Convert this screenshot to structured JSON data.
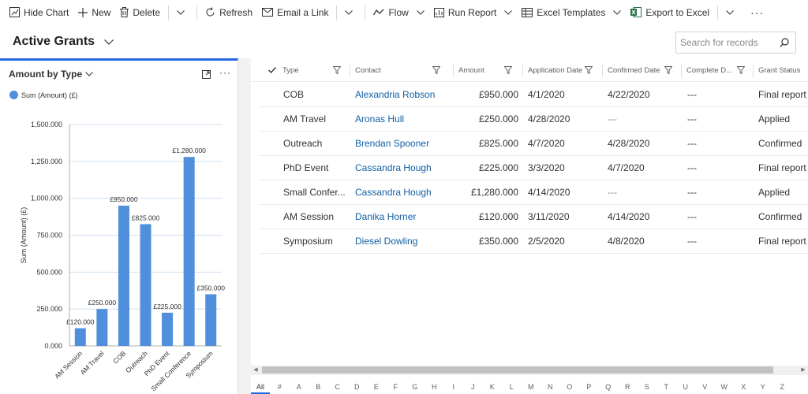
{
  "toolbar": {
    "hide_chart": "Hide Chart",
    "new": "New",
    "delete": "Delete",
    "refresh": "Refresh",
    "email_link": "Email a Link",
    "flow": "Flow",
    "run_report": "Run Report",
    "excel_templates": "Excel Templates",
    "export_excel": "Export to Excel",
    "more": "···"
  },
  "view": {
    "title": "Active Grants"
  },
  "search": {
    "placeholder": "Search for records"
  },
  "chart_panel": {
    "title": "Amount by Type",
    "more": "···",
    "legend": "Sum (Amount) (£)"
  },
  "chart_data": {
    "type": "bar",
    "categories": [
      "AM Session",
      "AM Travel",
      "COB",
      "Outreach",
      "PhD Event",
      "Small Conference",
      "Symposium"
    ],
    "series": [
      {
        "name": "Sum (Amount) (£)",
        "values": [
          120,
          250,
          950,
          825,
          225,
          1280,
          350
        ],
        "color": "#4f8fdc"
      }
    ],
    "data_labels": [
      "£120.000",
      "£250.000",
      "£950.000",
      "£825.000",
      "£225.000",
      "£1,280.000",
      "£350.000"
    ],
    "yticks": [
      0,
      250,
      500,
      750,
      1000,
      1250,
      1500
    ],
    "ytick_labels": [
      "0.000",
      "250.000",
      "500.000",
      "750.000",
      "1,000.000",
      "1,250.000",
      "1,500.000"
    ],
    "ylim": [
      0,
      1500
    ],
    "ylabel": "Sum (Amount) (£)",
    "xlabel": "",
    "grid": true,
    "legend_position": "top-left"
  },
  "grid": {
    "columns": [
      "Type",
      "Contact",
      "Amount",
      "Application Date",
      "Confirmed Date",
      "Complete D...",
      "Grant Status"
    ],
    "rows": [
      [
        "COB",
        "Alexandria Robson",
        "£950.000",
        "4/1/2020",
        "4/22/2020",
        "---",
        "Final report"
      ],
      [
        "AM Travel",
        "Aronas Hull",
        "£250.000",
        "4/28/2020",
        "---",
        "---",
        "Applied"
      ],
      [
        "Outreach",
        "Brendan Spooner",
        "£825.000",
        "4/7/2020",
        "4/28/2020",
        "---",
        "Confirmed"
      ],
      [
        "PhD Event",
        "Cassandra Hough",
        "£225.000",
        "3/3/2020",
        "4/7/2020",
        "---",
        "Final report"
      ],
      [
        "Small Confer...",
        "Cassandra Hough",
        "£1,280.000",
        "4/14/2020",
        "---",
        "---",
        "Applied"
      ],
      [
        "AM Session",
        "Danika Horner",
        "£120.000",
        "3/11/2020",
        "4/14/2020",
        "---",
        "Confirmed"
      ],
      [
        "Symposium",
        "Diesel Dowling",
        "£350.000",
        "2/5/2020",
        "4/8/2020",
        "---",
        "Final report"
      ]
    ]
  },
  "alphabet": [
    "All",
    "#",
    "A",
    "B",
    "C",
    "D",
    "E",
    "F",
    "G",
    "H",
    "I",
    "J",
    "K",
    "L",
    "M",
    "N",
    "O",
    "P",
    "Q",
    "R",
    "S",
    "T",
    "U",
    "V",
    "W",
    "X",
    "Y",
    "Z"
  ],
  "colors": {
    "accent": "#2266e3",
    "bar": "#4f8fdc",
    "link": "#115ea3",
    "excel_green": "#217346"
  }
}
